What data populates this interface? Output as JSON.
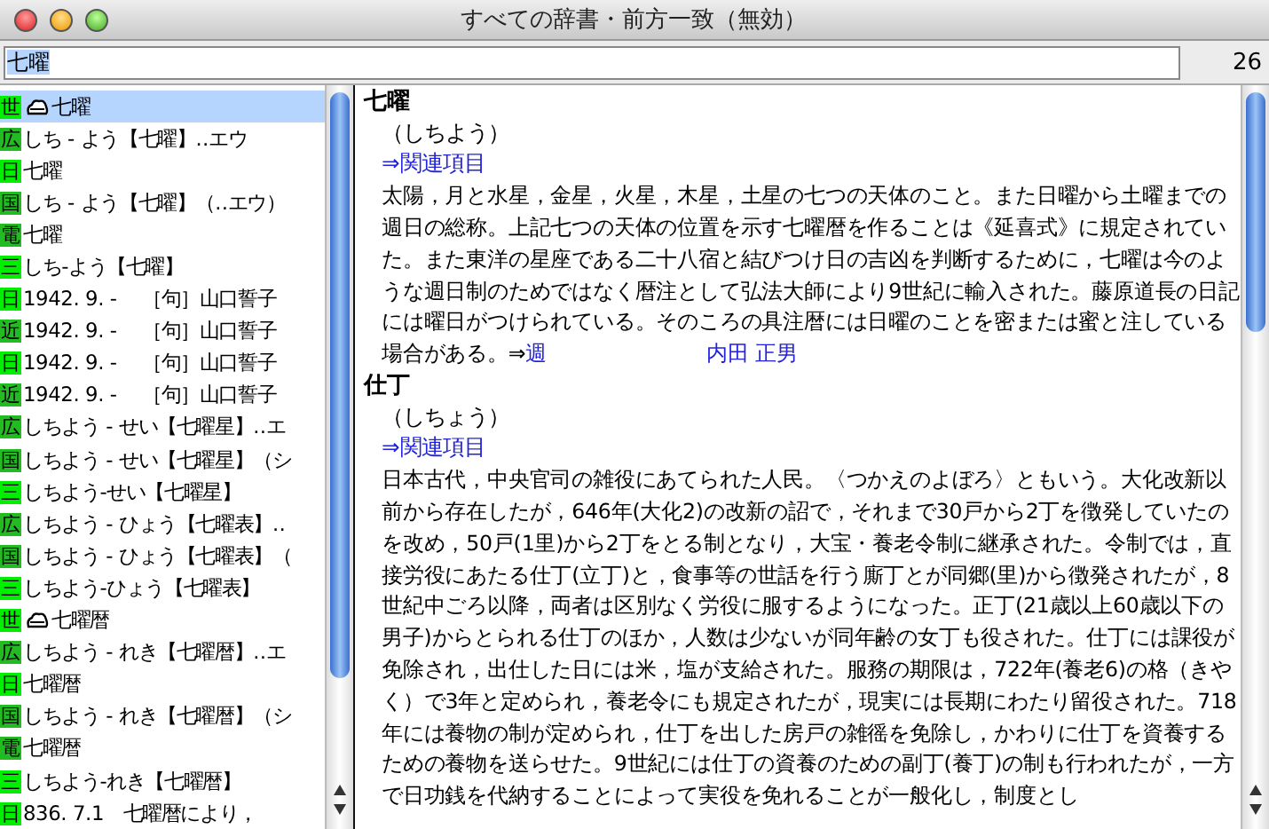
{
  "window": {
    "title": "すべての辞書・前方一致（無効）"
  },
  "search": {
    "value": "七曜",
    "count": "26"
  },
  "results": [
    {
      "badge": "世",
      "color": "#00ee00",
      "has_icon": true,
      "text": "七曜",
      "selected": true
    },
    {
      "badge": "広",
      "color": "#22bb22",
      "has_icon": false,
      "text": "しち - よう【七曜】‥エウ",
      "selected": false
    },
    {
      "badge": "日",
      "color": "#00ee00",
      "has_icon": false,
      "text": "七曜",
      "selected": false
    },
    {
      "badge": "国",
      "color": "#22bb22",
      "has_icon": false,
      "text": "しち - よう【七曜】（‥エウ）",
      "selected": false
    },
    {
      "badge": "電",
      "color": "#22bb22",
      "has_icon": false,
      "text": "七曜",
      "selected": false
    },
    {
      "badge": "三",
      "color": "#00ee00",
      "has_icon": false,
      "text": "しち‐よう【七曜】",
      "selected": false
    },
    {
      "badge": "日",
      "color": "#00ee00",
      "has_icon": false,
      "text": "1942. 9. -　 ［句］山口誓子",
      "selected": false
    },
    {
      "badge": "近",
      "color": "#22bb22",
      "has_icon": false,
      "text": "1942. 9. -　 ［句］山口誓子",
      "selected": false
    },
    {
      "badge": "日",
      "color": "#00ee00",
      "has_icon": false,
      "text": "1942. 9. -　 ［句］山口誓子",
      "selected": false
    },
    {
      "badge": "近",
      "color": "#22bb22",
      "has_icon": false,
      "text": "1942. 9. -　 ［句］山口誓子",
      "selected": false
    },
    {
      "badge": "広",
      "color": "#22bb22",
      "has_icon": false,
      "text": "しちよう - せい【七曜星】‥エ",
      "selected": false
    },
    {
      "badge": "国",
      "color": "#22bb22",
      "has_icon": false,
      "text": "しちよう - せい【七曜星】（シ",
      "selected": false
    },
    {
      "badge": "三",
      "color": "#00ee00",
      "has_icon": false,
      "text": "しちよう‐せい【七曜星】",
      "selected": false
    },
    {
      "badge": "広",
      "color": "#22bb22",
      "has_icon": false,
      "text": "しちよう - ひょう【七曜表】‥",
      "selected": false
    },
    {
      "badge": "国",
      "color": "#22bb22",
      "has_icon": false,
      "text": "しちよう - ひょう【七曜表】（",
      "selected": false
    },
    {
      "badge": "三",
      "color": "#00ee00",
      "has_icon": false,
      "text": "しちよう‐ひょう【七曜表】",
      "selected": false
    },
    {
      "badge": "世",
      "color": "#00ee00",
      "has_icon": true,
      "text": "七曜暦",
      "selected": false
    },
    {
      "badge": "広",
      "color": "#22bb22",
      "has_icon": false,
      "text": "しちよう - れき【七曜暦】‥エ",
      "selected": false
    },
    {
      "badge": "日",
      "color": "#00ee00",
      "has_icon": false,
      "text": "七曜暦",
      "selected": false
    },
    {
      "badge": "国",
      "color": "#22bb22",
      "has_icon": false,
      "text": "しちよう - れき【七曜暦】（シ",
      "selected": false
    },
    {
      "badge": "電",
      "color": "#22bb22",
      "has_icon": false,
      "text": "七曜暦",
      "selected": false
    },
    {
      "badge": "三",
      "color": "#00ee00",
      "has_icon": false,
      "text": "しちよう‐れき【七曜暦】",
      "selected": false
    },
    {
      "badge": "日",
      "color": "#00ee00",
      "has_icon": false,
      "text": "836.  7.1　七曜暦により，",
      "selected": false
    }
  ],
  "entries": [
    {
      "headword": "七曜",
      "reading": "（しちよう）",
      "related_link": "⇒関連項目",
      "body": "太陽，月と水星，金星，火星，木星，土星の七つの天体のこと。また日曜から土曜までの週日の総称。上記七つの天体の位置を示す七曜暦を作ることは《延喜式》に規定されていた。また東洋の星座である二十八宿と結びつけ日の吉凶を判断するために，七曜は今のような週日制のためではなく暦注として弘法大師により9世紀に輸入された。藤原道長の日記には曜日がつけられている。そのころの具注暦には日曜のことを密または蜜と注している場合がある。⇒",
      "xref": "週",
      "author": "内田 正男"
    },
    {
      "headword": "仕丁",
      "reading": "（しちょう）",
      "related_link": "⇒関連項目",
      "body": "日本古代，中央官司の雑役にあてられた人民。〈つかえのよぼろ〉ともいう。大化改新以前から存在したが，646年(大化2)の改新の詔で，それまで30戸から2丁を徴発していたのを改め，50戸(1里)から2丁をとる制となり，大宝・養老令制に継承された。令制では，直接労役にあたる仕丁(立丁)と，食事等の世話を行う廝丁とが同郷(里)から徴発されたが，8世紀中ごろ以降，両者は区別なく労役に服するようになった。正丁(21歳以上60歳以下の男子)からとられる仕丁のほか，人数は少ないが同年齢の女丁も役された。仕丁には課役が免除され，出仕した日には米，塩が支給された。服務の期限は，722年(養老6)の格（きやく）で3年と定められ，養老令にも規定されたが，現実には長期にわたり留役された。718年には養物の制が定められ，仕丁を出した房戸の雑徭を免除し，かわりに仕丁を資養するための養物を送らせた。9世紀には仕丁の資養のための副丁(養丁)の制も行われたが，一方で日功銭を代納することによって実役を免れることが一般化し，制度とし"
    }
  ]
}
